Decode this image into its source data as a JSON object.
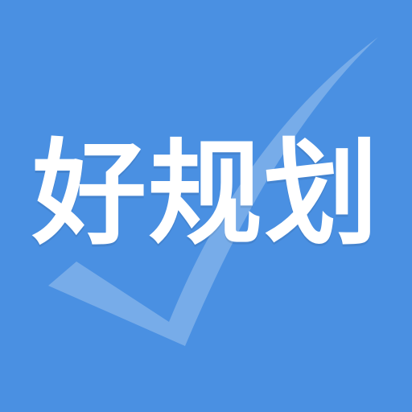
{
  "app_icon": {
    "title": "好规划",
    "background_color": "#4a90e2",
    "text_color": "#ffffff",
    "decoration": "checkmark-icon"
  }
}
